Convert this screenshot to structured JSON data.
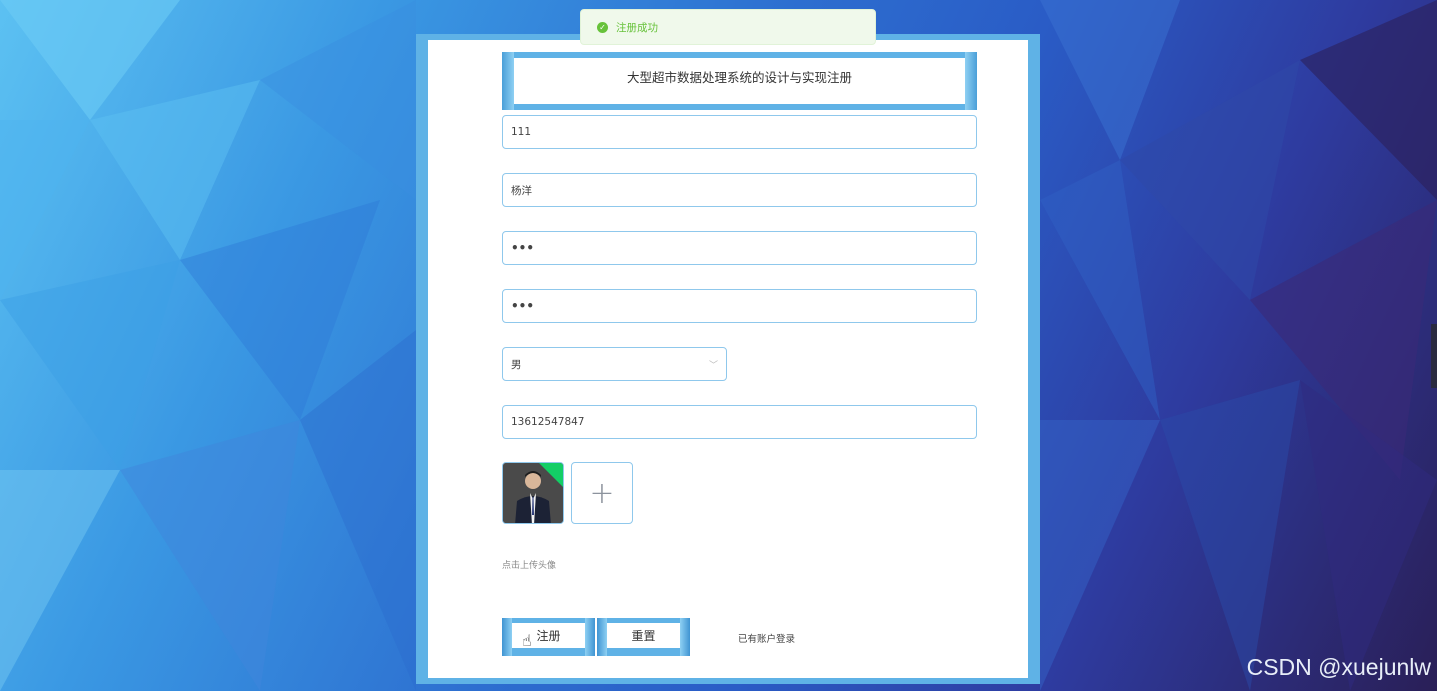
{
  "toast": {
    "message": "注册成功",
    "icon": "check-circle-icon"
  },
  "form": {
    "title": "大型超市数据处理系统的设计与实现注册",
    "fields": {
      "account": "111",
      "name": "杨洋",
      "password": "•••",
      "confirm_password": "•••",
      "gender": "男",
      "phone": "13612547847"
    },
    "upload": {
      "tip": "点击上传头像",
      "add_icon": "plus-icon"
    },
    "buttons": {
      "register": "注册",
      "reset": "重置"
    },
    "login_link": "已有账户登录"
  },
  "watermark": "CSDN @xuejunlw",
  "colors": {
    "accent": "#5fb2e6",
    "border": "#8fc8ec",
    "success": "#67c23a"
  }
}
